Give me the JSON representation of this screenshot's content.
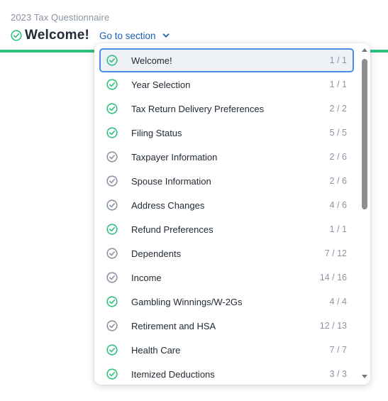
{
  "header": {
    "questionnaire_title": "2023 Tax Questionnaire",
    "page_title": "Welcome!",
    "goto_label": "Go to section"
  },
  "colors": {
    "complete": "#2ec27e",
    "incomplete": "#8a94a3",
    "accent": "#1a5fb4",
    "selected_border": "#4a90e2"
  },
  "sections": [
    {
      "label": "Welcome!",
      "count": "1 / 1",
      "status": "complete",
      "selected": true
    },
    {
      "label": "Year Selection",
      "count": "1 / 1",
      "status": "complete"
    },
    {
      "label": "Tax Return Delivery Preferences",
      "count": "2 / 2",
      "status": "complete"
    },
    {
      "label": "Filing Status",
      "count": "5 / 5",
      "status": "complete"
    },
    {
      "label": "Taxpayer Information",
      "count": "2 / 6",
      "status": "incomplete"
    },
    {
      "label": "Spouse Information",
      "count": "2 / 6",
      "status": "incomplete"
    },
    {
      "label": "Address Changes",
      "count": "4 / 6",
      "status": "incomplete"
    },
    {
      "label": "Refund Preferences",
      "count": "1 / 1",
      "status": "complete"
    },
    {
      "label": "Dependents",
      "count": "7 / 12",
      "status": "incomplete"
    },
    {
      "label": "Income",
      "count": "14 / 16",
      "status": "incomplete"
    },
    {
      "label": "Gambling Winnings/W-2Gs",
      "count": "4 / 4",
      "status": "complete"
    },
    {
      "label": "Retirement and HSA",
      "count": "12 / 13",
      "status": "incomplete"
    },
    {
      "label": "Health Care",
      "count": "7 / 7",
      "status": "complete"
    },
    {
      "label": "Itemized Deductions",
      "count": "3 / 3",
      "status": "complete"
    }
  ]
}
